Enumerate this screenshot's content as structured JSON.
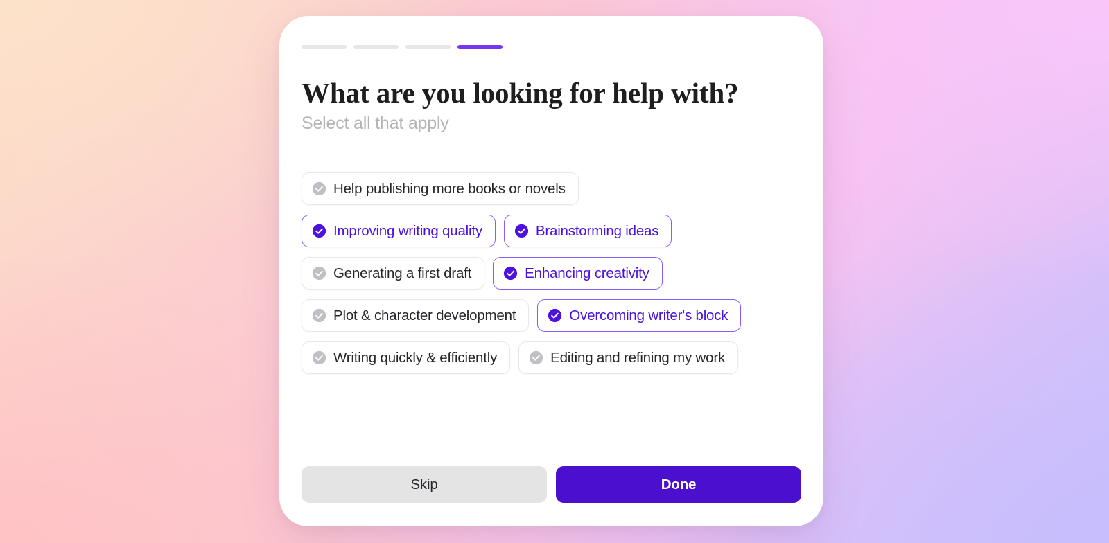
{
  "background": {
    "corner_colors": {
      "top_left": "#FDE2CA",
      "top_right": "#FAC6FA",
      "bottom_left": "#FFC2C5",
      "bottom_right": "#C8BEFD"
    }
  },
  "colors": {
    "accent_purple": "#7437F0",
    "selected_text": "#4B12E0",
    "selected_border": "#8B5CF6",
    "primary_button": "#4B10CE",
    "unselected_icon": "#BFBFC4",
    "progress_inactive": "#E6E6E6"
  },
  "progress": {
    "total_steps": 4,
    "current_step": 4,
    "segments": [
      {
        "state": "inactive"
      },
      {
        "state": "inactive"
      },
      {
        "state": "inactive"
      },
      {
        "state": "active"
      }
    ]
  },
  "header": {
    "title": "What are you looking for help with?",
    "subtitle": "Select all that apply"
  },
  "options": [
    {
      "label": "Help publishing more books or novels",
      "selected": false,
      "icon": "check-circle-icon"
    },
    {
      "label": "Improving writing quality",
      "selected": true,
      "icon": "check-circle-icon"
    },
    {
      "label": "Brainstorming ideas",
      "selected": true,
      "icon": "check-circle-icon"
    },
    {
      "label": "Generating a first draft",
      "selected": false,
      "icon": "check-circle-icon"
    },
    {
      "label": "Enhancing creativity",
      "selected": true,
      "icon": "check-circle-icon"
    },
    {
      "label": "Plot & character development",
      "selected": false,
      "icon": "check-circle-icon"
    },
    {
      "label": "Overcoming writer's block",
      "selected": true,
      "icon": "check-circle-icon"
    },
    {
      "label": "Writing quickly & efficiently",
      "selected": false,
      "icon": "check-circle-icon"
    },
    {
      "label": "Editing and refining my work",
      "selected": false,
      "icon": "check-circle-icon"
    }
  ],
  "footer": {
    "skip_label": "Skip",
    "done_label": "Done"
  }
}
